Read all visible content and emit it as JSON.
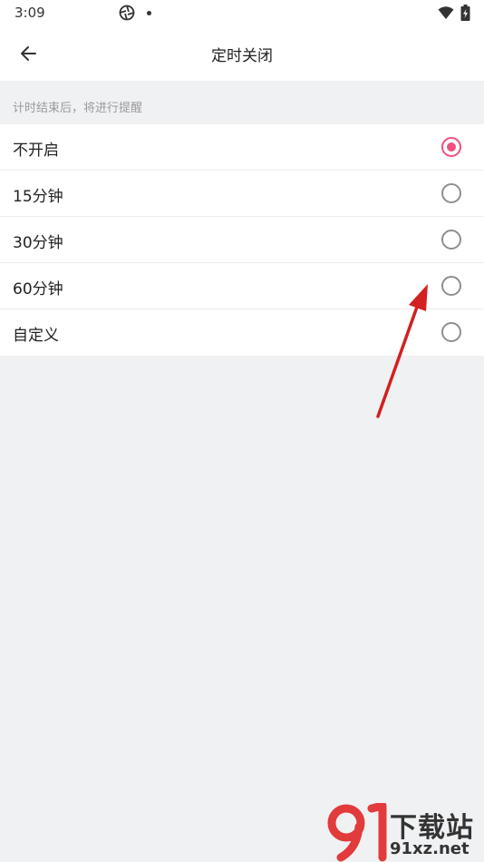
{
  "status_bar": {
    "time": "3:09"
  },
  "header": {
    "back_icon": "arrow-left-icon",
    "title": "定时关闭"
  },
  "hint": "计时结束后，将进行提醒",
  "options": [
    {
      "label": "不开启",
      "checked": true
    },
    {
      "label": "15分钟",
      "checked": false
    },
    {
      "label": "30分钟",
      "checked": false
    },
    {
      "label": "60分钟",
      "checked": false
    },
    {
      "label": "自定义",
      "checked": false
    }
  ],
  "colors": {
    "accent": "#f0507d",
    "background": "#f0f1f3",
    "annotation_arrow": "#d42020"
  },
  "watermark": {
    "title": "下载站",
    "url": "91xz.net"
  }
}
